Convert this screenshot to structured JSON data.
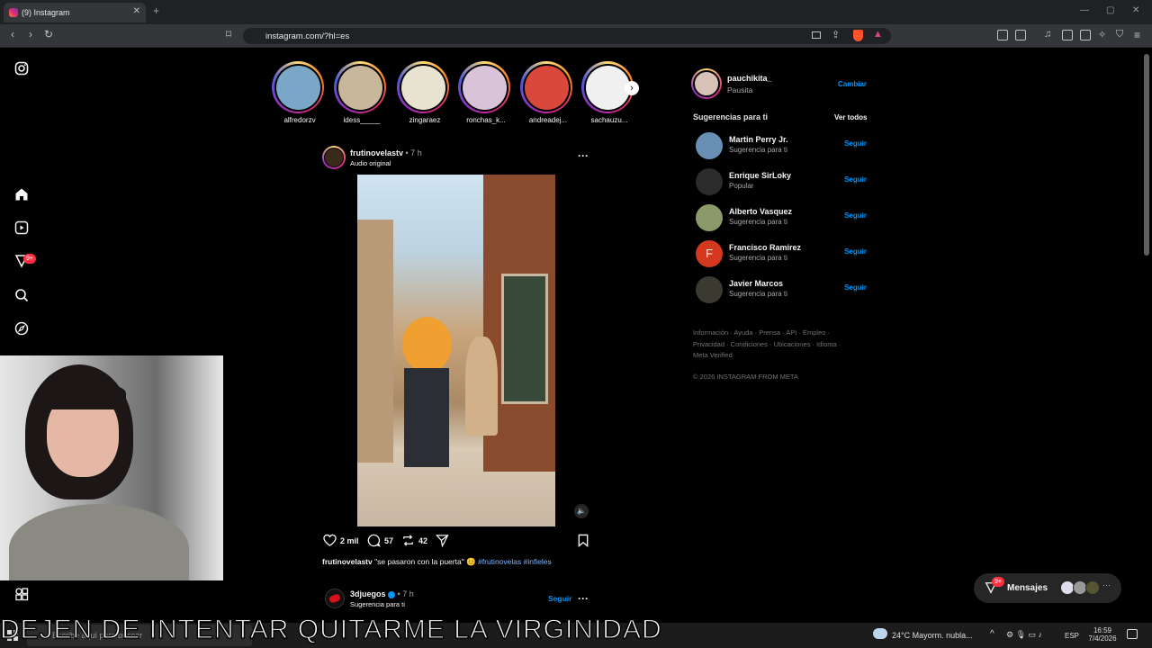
{
  "browser": {
    "tab_title": "(9) Instagram",
    "new_tab": "+",
    "url": "instagram.com/?hl=es"
  },
  "stories": [
    {
      "user": "alfredorzv",
      "color": "#7aa7c7"
    },
    {
      "user": "idess_____",
      "color": "#c9b79c"
    },
    {
      "user": "zingaraez",
      "color": "#e8e2d0"
    },
    {
      "user": "ronchas_k...",
      "color": "#d9c3d9"
    },
    {
      "user": "andreadej...",
      "color": "#d9483a"
    },
    {
      "user": "sachauzu...",
      "color": "#f0f0f0"
    }
  ],
  "sidebar": {
    "notifications_badge": "9+"
  },
  "post": {
    "author": "frutinovelastv",
    "time": "• 7 h",
    "audio": "Audio original",
    "likes": "2 mil",
    "comments": "57",
    "reposts": "42",
    "caption_author": "frutinovelastv",
    "caption_text": "\"se pasaron con la puerta\" 😊",
    "hashtags": "#frutinovelas #infieles"
  },
  "next_post": {
    "author": "3djuegos",
    "time": "• 7 h",
    "subtitle": "Sugerencia para ti",
    "follow": "Seguir"
  },
  "profile": {
    "username": "pauchikita_",
    "name": "Pausita",
    "switch": "Cambiar"
  },
  "suggestions": {
    "title": "Sugerencias para ti",
    "see_all": "Ver todos",
    "follow_label": "Seguir",
    "items": [
      {
        "name": "Martin Perry Jr.",
        "sub": "Sugerencia para ti",
        "color": "#6a8fb5"
      },
      {
        "name": "Enrique SirLoky",
        "sub": "Popular",
        "color": "#2b2b2b"
      },
      {
        "name": "Alberto Vasquez",
        "sub": "Sugerencia para ti",
        "color": "#8a9a6a"
      },
      {
        "name": "Francisco Ramirez",
        "sub": "Sugerencia para ti",
        "color": "#d4381e",
        "initial": "F"
      },
      {
        "name": "Javier Marcos",
        "sub": "Sugerencia para ti",
        "color": "#3a3a30"
      }
    ]
  },
  "footer": {
    "line1": "Información · Ayuda · Prensa · API · Empleo ·",
    "line2": "Privacidad · Condiciones · Ubicaciones · Idioma ·",
    "line3": "Meta Verified",
    "copyright": "© 2026 INSTAGRAM FROM META"
  },
  "messages": {
    "label": "Mensajes",
    "badge": "9+"
  },
  "overlay_caption": "DEJEN DE INTENTAR QUITARME LA VIRGINIDAD",
  "taskbar": {
    "search": "Escribe aquí para buscar",
    "weather": "24°C  Mayorm. nubla...",
    "lang": "ESP",
    "time": "16:59",
    "date": "7/4/2026"
  }
}
